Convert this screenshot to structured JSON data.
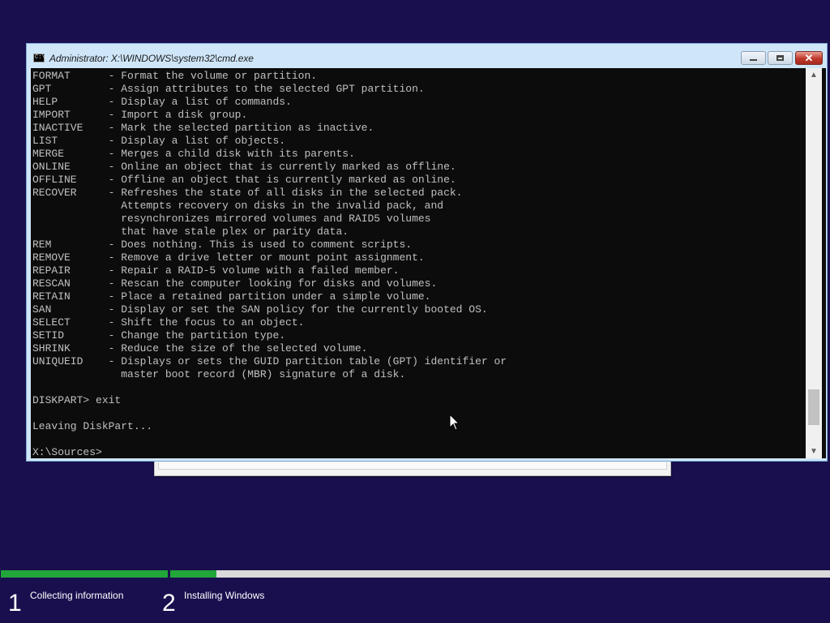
{
  "window": {
    "title": "Administrator: X:\\WINDOWS\\system32\\cmd.exe",
    "icon_text": "C:\\",
    "buttons": {
      "minimize": "minimize-icon",
      "maximize": "maximize-icon",
      "close": "close-icon",
      "close_glyph": "✕"
    }
  },
  "console": {
    "lines": [
      "FORMAT      - Format the volume or partition.",
      "GPT         - Assign attributes to the selected GPT partition.",
      "HELP        - Display a list of commands.",
      "IMPORT      - Import a disk group.",
      "INACTIVE    - Mark the selected partition as inactive.",
      "LIST        - Display a list of objects.",
      "MERGE       - Merges a child disk with its parents.",
      "ONLINE      - Online an object that is currently marked as offline.",
      "OFFLINE     - Offline an object that is currently marked as online.",
      "RECOVER     - Refreshes the state of all disks in the selected pack.",
      "              Attempts recovery on disks in the invalid pack, and",
      "              resynchronizes mirrored volumes and RAID5 volumes",
      "              that have stale plex or parity data.",
      "REM         - Does nothing. This is used to comment scripts.",
      "REMOVE      - Remove a drive letter or mount point assignment.",
      "REPAIR      - Repair a RAID-5 volume with a failed member.",
      "RESCAN      - Rescan the computer looking for disks and volumes.",
      "RETAIN      - Place a retained partition under a simple volume.",
      "SAN         - Display or set the SAN policy for the currently booted OS.",
      "SELECT      - Shift the focus to an object.",
      "SETID       - Change the partition type.",
      "SHRINK      - Reduce the size of the selected volume.",
      "UNIQUEID    - Displays or sets the GUID partition table (GPT) identifier or",
      "              master boot record (MBR) signature of a disk.",
      "",
      "DISKPART> exit",
      "",
      "Leaving DiskPart...",
      "",
      "X:\\Sources>"
    ]
  },
  "scrollbar": {
    "up_glyph": "▲",
    "down_glyph": "▼",
    "position_fraction": 0.88
  },
  "setup_progress": {
    "steps": [
      {
        "number": "1",
        "label": "Collecting information",
        "progress": 1.0
      },
      {
        "number": "2",
        "label": "Installing Windows",
        "progress": 0.07
      }
    ],
    "colors": {
      "fill": "#22a63a",
      "track": "#d9d9d9",
      "background": "#1a0f4e"
    }
  }
}
